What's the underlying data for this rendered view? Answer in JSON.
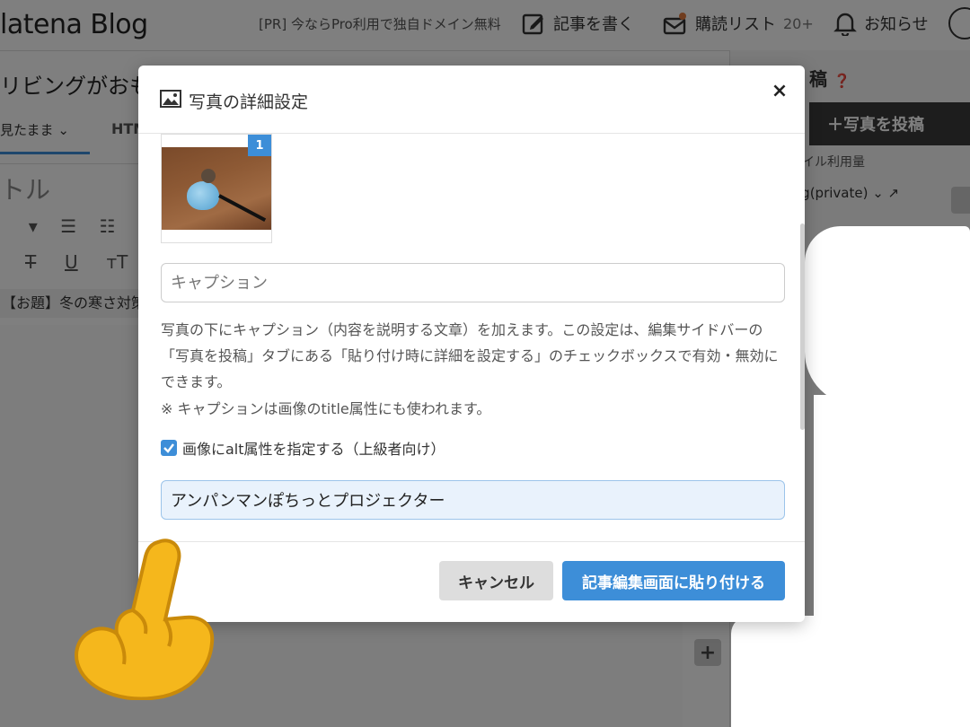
{
  "app": {
    "logo": "latena Blog",
    "promo": "[PR] 今ならPro利用で独自ドメイン無料",
    "nav": {
      "write": "記事を書く",
      "subscriptions": "購読リスト",
      "subscriptions_count": "20+",
      "notifications": "お知らせ"
    },
    "article_name": "リビングがおもち",
    "tabs": {
      "view": "見たまま",
      "html": "HTM"
    },
    "title_placeholder": "トル",
    "odai": "【お題】冬の寒さ対策",
    "sidebar": {
      "heading": "稿",
      "post_photo": "写真を投稿",
      "usage": "イル利用量",
      "blog_select": "og(private)"
    }
  },
  "modal": {
    "title": "写真の詳細設定",
    "close": "×",
    "image_badge": "1",
    "caption_placeholder": "キャプション",
    "caption_value": "",
    "help_text": "写真の下にキャプション（内容を説明する文章）を加えます。この設定は、編集サイドバーの「写真を投稿」タブにある「貼り付け時に詳細を設定する」のチェックボックスで有効・無効にできます。",
    "note": "※ キャプションは画像のtitle属性にも使われます。",
    "alt_checkbox_label": "画像にalt属性を指定する（上級者向け）",
    "alt_checked": true,
    "alt_value": "アンパンマンぽちっとプロジェクター",
    "cancel": "キャンセル",
    "paste": "記事編集画面に貼り付ける"
  },
  "colors": {
    "accent": "#3d8ed8",
    "cancel_bg": "#dddddd",
    "alt_bg": "#e9f2fc"
  }
}
